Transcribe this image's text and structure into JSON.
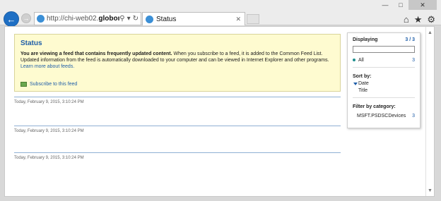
{
  "window": {
    "minimize_glyph": "—",
    "maximize_glyph": "□",
    "close_glyph": "✕"
  },
  "nav": {
    "back_glyph": "←",
    "forward_glyph": "→"
  },
  "address_bar": {
    "url_prefix": "http://chi-web02.",
    "url_domain": "globom",
    "search_glyph": "⚲",
    "dropdown_glyph": "▾",
    "refresh_glyph": "↻"
  },
  "tab": {
    "title": "Status",
    "close_glyph": "✕"
  },
  "toolbar": {
    "home_glyph": "⌂",
    "favorites_glyph": "★",
    "settings_glyph": "⚙"
  },
  "feed_status": {
    "title": "Status",
    "bold_text": "You are viewing a feed that contains frequently updated content.",
    "text_1": " When you subscribe to a feed, it is added to the Common Feed List.",
    "text_2": "Updated information from the feed is automatically downloaded to your computer and can be viewed in Internet Explorer and other programs.",
    "learn_more": "Learn more about feeds.",
    "subscribe": "Subscribe to this feed"
  },
  "entries": [
    {
      "date": "Today, February 9, 2015, 3:10:24 PM"
    },
    {
      "date": "Today, February 9, 2015, 3:10:24 PM"
    },
    {
      "date": "Today, February 9, 2015, 3:10:24 PM"
    }
  ],
  "sidebar": {
    "displaying_label": "Displaying",
    "displaying_count": "3 / 3",
    "all_label": "All",
    "all_count": "3",
    "sort_by_label": "Sort by:",
    "sort_options": [
      "Date",
      "Title"
    ],
    "filter_label": "Filter by category:",
    "category_name": "MSFT.PSDSCDevices",
    "category_count": "3"
  },
  "scrollbar": {
    "up_glyph": "▲",
    "down_glyph": "▼"
  }
}
